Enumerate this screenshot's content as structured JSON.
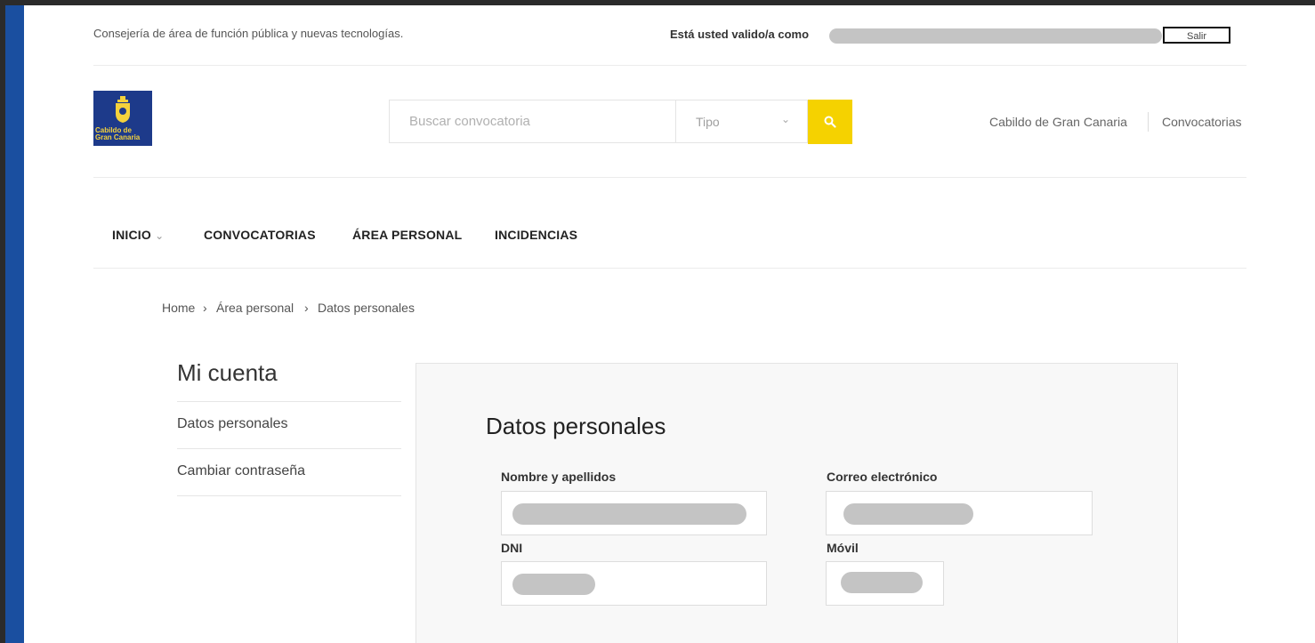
{
  "topbar": {
    "department": "Consejería de área de función pública y nuevas tecnologías.",
    "logged_as": "Está usted valido/a como",
    "logout_label": "Salir"
  },
  "header": {
    "logo_text_line1": "Cabildo de",
    "logo_text_line2": "Gran Canaria",
    "search_placeholder": "Buscar convocatoria",
    "type_select_value": "Tipo",
    "links": [
      "Cabildo de Gran Canaria",
      "Convocatorias"
    ]
  },
  "nav": {
    "items": [
      "INICIO",
      "CONVOCATORIAS",
      "ÁREA PERSONAL",
      "INCIDENCIAS"
    ]
  },
  "breadcrumb": {
    "items": [
      "Home",
      "Área personal",
      "Datos personales"
    ],
    "separator": "›"
  },
  "sidebar": {
    "title": "Mi cuenta",
    "items": [
      "Datos personales",
      "Cambiar contraseña"
    ]
  },
  "main": {
    "title": "Datos personales",
    "fields": {
      "name_label": "Nombre y apellidos",
      "email_label": "Correo electrónico",
      "dni_label": "DNI",
      "mobile_label": "Móvil"
    }
  },
  "colors": {
    "accent_left_bar": "#1a4fa0",
    "search_button": "#f5d200",
    "redacted": "#c4c4c4"
  },
  "icons": {
    "search_button": "search-icon",
    "type_select": "chevron-down-icon",
    "nav_inicio": "chevron-down-icon"
  }
}
